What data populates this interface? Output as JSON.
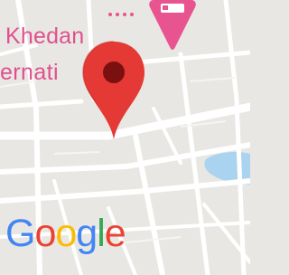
{
  "map": {
    "place_label_line1": "Khedan",
    "place_label_line2": "ernati",
    "logo_letters": [
      {
        "char": "G",
        "color": "#4285F4"
      },
      {
        "char": "o",
        "color": "#EA4335"
      },
      {
        "char": "o",
        "color": "#FBBC05"
      },
      {
        "char": "g",
        "color": "#4285F4"
      },
      {
        "char": "l",
        "color": "#34A853"
      },
      {
        "char": "e",
        "color": "#EA4335"
      }
    ],
    "marker_icon": "map-pin-icon",
    "poi_icon": "hotel-poi-icon",
    "colors": {
      "land": "#e9e7e3",
      "road": "#ffffff",
      "water": "#a9d3ee",
      "pin": "#e53935",
      "poi": "#e8548f",
      "label": "#e0508f"
    }
  }
}
